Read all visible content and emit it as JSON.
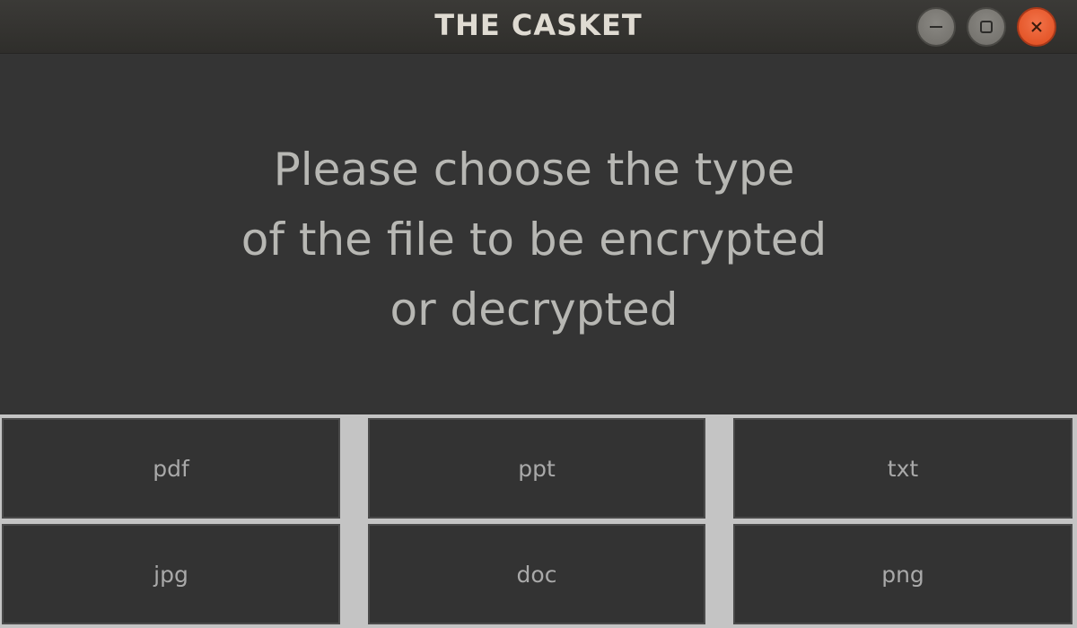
{
  "window": {
    "title": "THE CASKET",
    "controls": {
      "minimize": "minimize-icon",
      "maximize": "maximize-icon",
      "close": "close-icon"
    }
  },
  "message": {
    "line1": "Please choose the type",
    "line2": "of the file to be encrypted",
    "line3": "or decrypted"
  },
  "file_types": {
    "row1": [
      "pdf",
      "ppt",
      "txt"
    ],
    "row2": [
      "jpg",
      "doc",
      "png"
    ]
  },
  "colors": {
    "background": "#343434",
    "close_button": "#df4b1c",
    "grid_lines": "#c4c4c4"
  }
}
